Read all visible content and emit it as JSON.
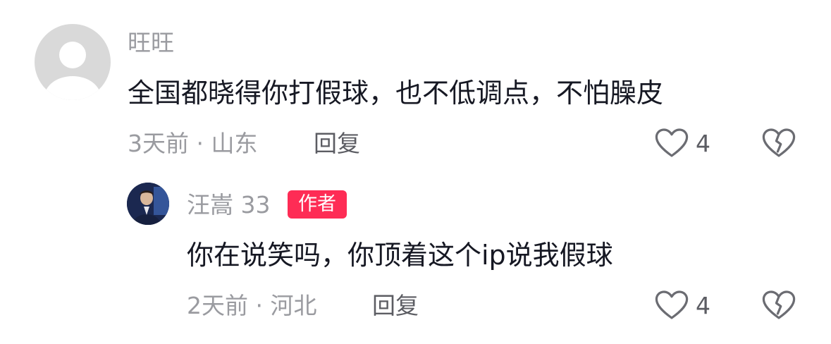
{
  "comments": [
    {
      "username": "旺旺",
      "text": "全国都晓得你打假球，也不低调点，不怕臊皮",
      "time": "3天前",
      "separator": "·",
      "location": "山东",
      "reply_label": "回复",
      "likes": "4"
    }
  ],
  "replies": [
    {
      "username": "汪嵩 33",
      "badge": "作者",
      "text": "你在说笑吗，你顶着这个ip说我假球",
      "time": "2天前",
      "separator": "·",
      "location": "河北",
      "reply_label": "回复",
      "likes": "4"
    }
  ],
  "icons": {
    "like": "heart-outline-icon",
    "dislike": "broken-heart-icon"
  },
  "colors": {
    "author_badge": "#fe2c55",
    "secondary_text": "#9a9ba0",
    "primary_text": "#161823"
  }
}
